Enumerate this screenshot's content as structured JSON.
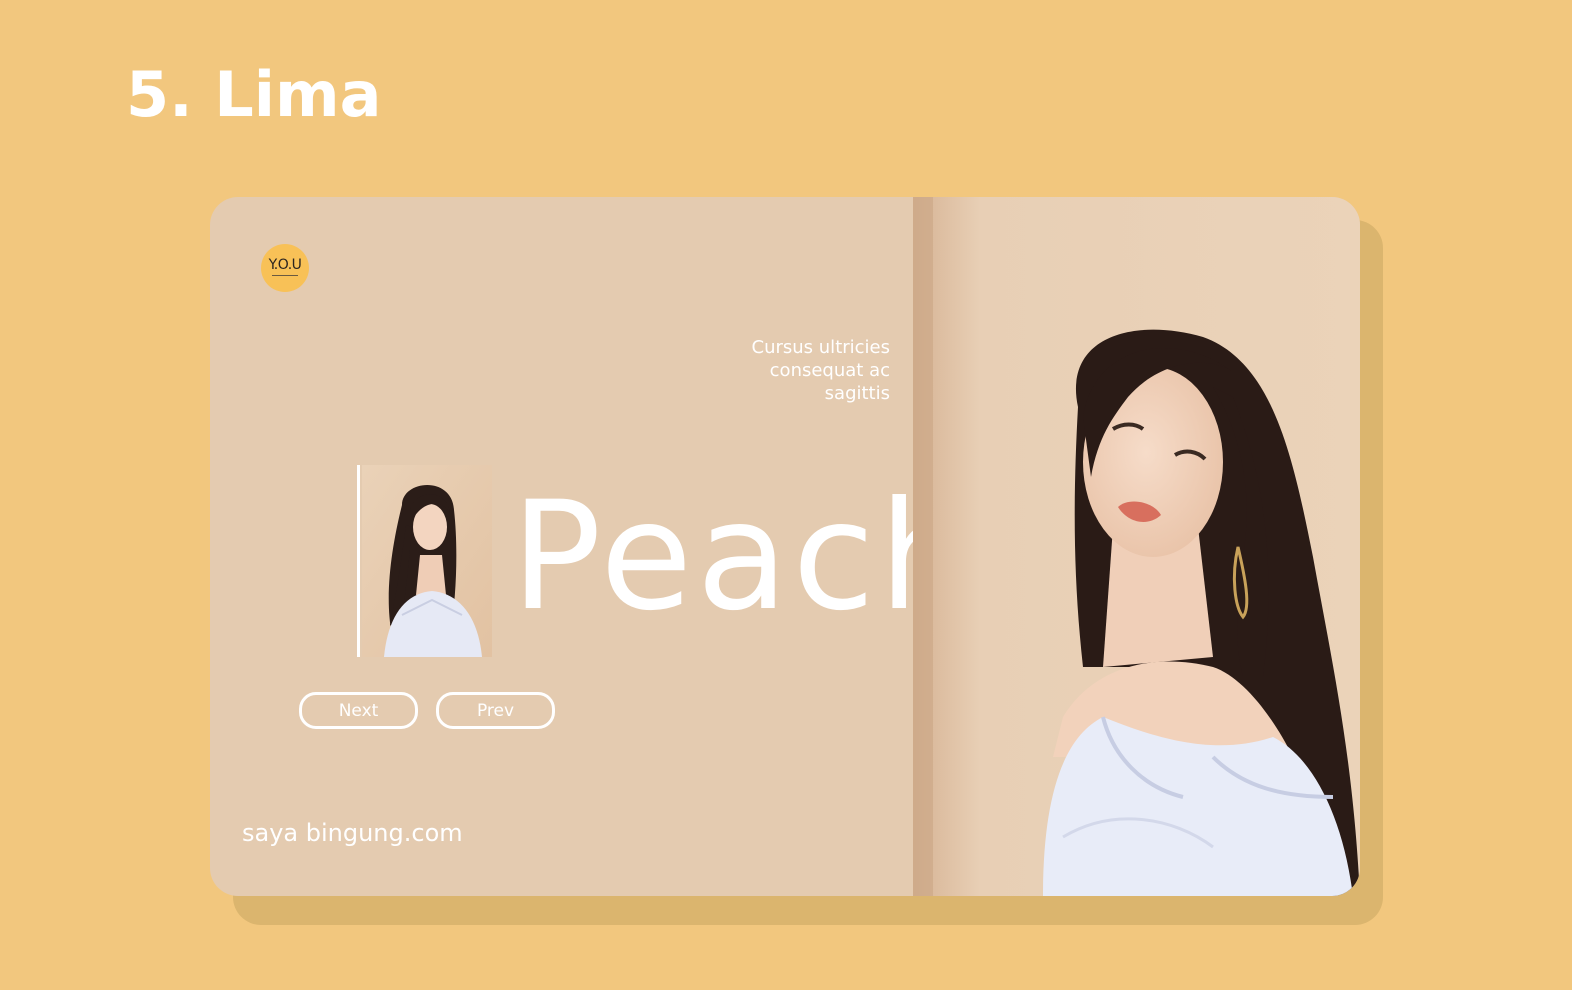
{
  "heading": "5. Lima",
  "card": {
    "logo_text": "Y.O.U",
    "tagline": [
      "Cursus ultricies",
      "consequat ac",
      "sagittis"
    ],
    "title": "Peach",
    "next_label": "Next",
    "prev_label": "Prev",
    "url": "saya bingung.com"
  },
  "colors": {
    "page_background": "#F2C77E",
    "card_background": "#E4CBB0",
    "card_shadow": "#DBB56E",
    "logo_background": "#F8C157",
    "text": "#FFFFFF"
  }
}
